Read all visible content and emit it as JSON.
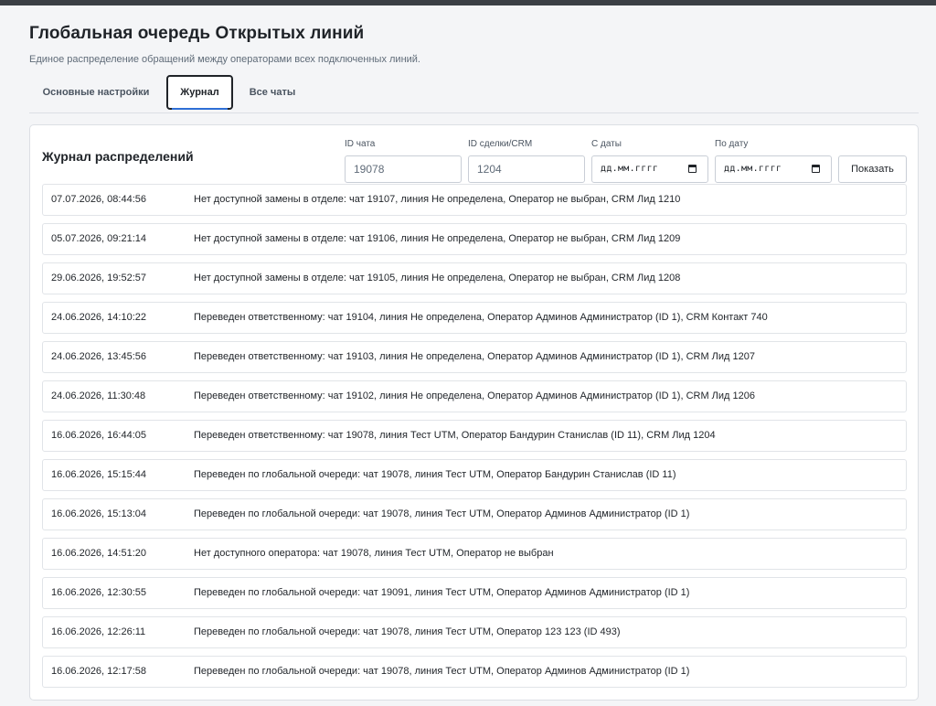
{
  "page": {
    "title": "Глобальная очередь Открытых линий",
    "subtitle": "Единое распределение обращений между операторами всех подключенных линий."
  },
  "tabs": [
    {
      "label": "Основные настройки",
      "active": false
    },
    {
      "label": "Журнал",
      "active": true
    },
    {
      "label": "Все чаты",
      "active": false
    }
  ],
  "journal": {
    "title": "Журнал распределений",
    "filters": {
      "chat_id_label": "ID чата",
      "chat_id_value": "19078",
      "deal_id_label": "ID сделки/CRM",
      "deal_id_value": "1204",
      "date_from_label": "С даты",
      "date_from_placeholder": "дд.мм.гггг",
      "date_to_label": "По дату",
      "date_to_placeholder": "дд.мм.гггг",
      "show_label": "Показать"
    },
    "entries": [
      {
        "date": "07.07.2026, 08:44:56",
        "message": "Нет доступной замены в отделе: чат 19107, линия Не определена, Оператор не выбран, CRM Лид 1210"
      },
      {
        "date": "05.07.2026, 09:21:14",
        "message": "Нет доступной замены в отделе: чат 19106, линия Не определена, Оператор не выбран, CRM Лид 1209"
      },
      {
        "date": "29.06.2026, 19:52:57",
        "message": "Нет доступной замены в отделе: чат 19105, линия Не определена, Оператор не выбран, CRM Лид 1208"
      },
      {
        "date": "24.06.2026, 14:10:22",
        "message": "Переведен ответственному: чат 19104, линия Не определена, Оператор Админов Администратор (ID 1), CRM Контакт 740"
      },
      {
        "date": "24.06.2026, 13:45:56",
        "message": "Переведен ответственному: чат 19103, линия Не определена, Оператор Админов Администратор (ID 1), CRM Лид 1207"
      },
      {
        "date": "24.06.2026, 11:30:48",
        "message": "Переведен ответственному: чат 19102, линия Не определена, Оператор Админов Администратор (ID 1), CRM Лид 1206"
      },
      {
        "date": "16.06.2026, 16:44:05",
        "message": "Переведен ответственному: чат 19078, линия Тест UTM, Оператор Бандурин Станислав (ID 11), CRM Лид 1204"
      },
      {
        "date": "16.06.2026, 15:15:44",
        "message": "Переведен по глобальной очереди: чат 19078, линия Тест UTM, Оператор Бандурин Станислав (ID 11)"
      },
      {
        "date": "16.06.2026, 15:13:04",
        "message": "Переведен по глобальной очереди: чат 19078, линия Тест UTM, Оператор Админов Администратор (ID 1)"
      },
      {
        "date": "16.06.2026, 14:51:20",
        "message": "Нет доступного оператора: чат 19078, линия Тест UTM, Оператор не выбран"
      },
      {
        "date": "16.06.2026, 12:30:55",
        "message": "Переведен по глобальной очереди: чат 19091, линия Тест UTM, Оператор Админов Администратор (ID 1)"
      },
      {
        "date": "16.06.2026, 12:26:11",
        "message": "Переведен по глобальной очереди: чат 19078, линия Тест UTM, Оператор 123 123 (ID 493)"
      },
      {
        "date": "16.06.2026, 12:17:58",
        "message": "Переведен по глобальной очереди: чат 19078, линия Тест UTM, Оператор Админов Администратор (ID 1)"
      }
    ]
  },
  "icons": {
    "date_picker": "calendar-icon"
  }
}
